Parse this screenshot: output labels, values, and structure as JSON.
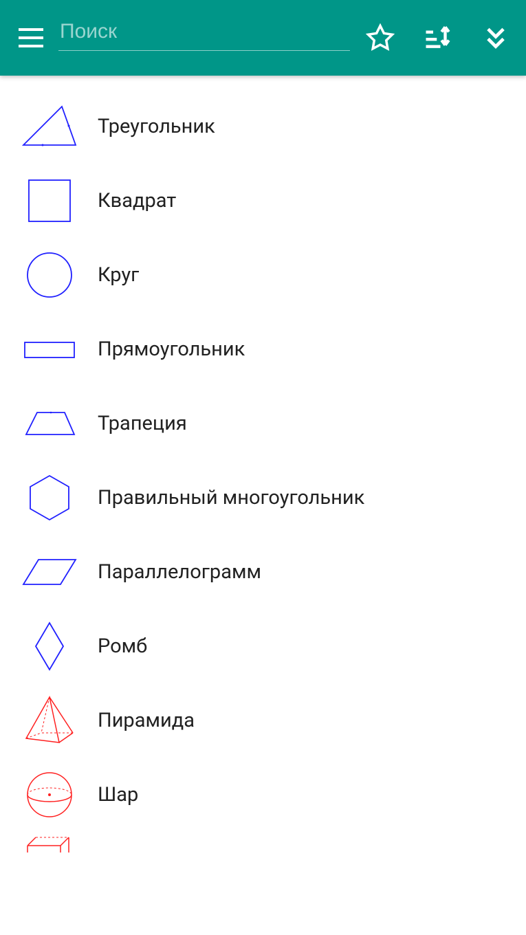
{
  "header": {
    "search_placeholder": "Поиск",
    "icons": {
      "menu": "menu",
      "favorite": "star-outline",
      "sort": "sort",
      "expand": "chevron-double-down"
    }
  },
  "shapes": {
    "blue": "#2020ff",
    "red": "#ff2020",
    "items": [
      {
        "id": "triangle",
        "label": "Треугольник",
        "color": "blue"
      },
      {
        "id": "square",
        "label": "Квадрат",
        "color": "blue"
      },
      {
        "id": "circle",
        "label": "Круг",
        "color": "blue"
      },
      {
        "id": "rectangle",
        "label": "Прямоугольник",
        "color": "blue"
      },
      {
        "id": "trapezoid",
        "label": "Трапеция",
        "color": "blue"
      },
      {
        "id": "polygon",
        "label": "Правильный многоугольник",
        "color": "blue"
      },
      {
        "id": "parallelogram",
        "label": "Параллелограмм",
        "color": "blue"
      },
      {
        "id": "rhombus",
        "label": "Ромб",
        "color": "blue"
      },
      {
        "id": "pyramid",
        "label": "Пирамида",
        "color": "red"
      },
      {
        "id": "sphere",
        "label": "Шар",
        "color": "red"
      },
      {
        "id": "cuboid",
        "label": "",
        "color": "red"
      }
    ]
  }
}
